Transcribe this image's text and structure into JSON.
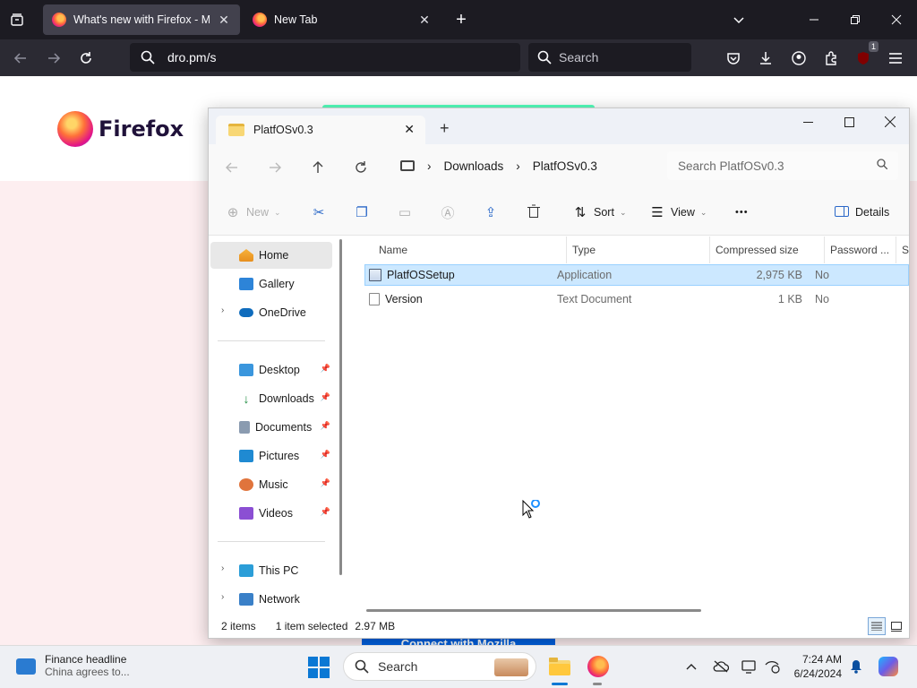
{
  "browser": {
    "tabs": [
      {
        "title": "What's new with Firefox - More",
        "close": "✕"
      },
      {
        "title": "New Tab",
        "close": "✕"
      }
    ],
    "new_tab": "+",
    "url": "dro.pm/s",
    "search_placeholder": "Search",
    "extension_badge": "1"
  },
  "page": {
    "logo_text": "Firefox",
    "cta": "Connect with Mozilla"
  },
  "explorer": {
    "tab_title": "PlatfOSv0.3",
    "breadcrumb": [
      "Downloads",
      "PlatfOSv0.3"
    ],
    "search_placeholder": "Search PlatfOSv0.3",
    "toolbar": {
      "new": "New",
      "sort": "Sort",
      "view": "View",
      "more": "•••",
      "details": "Details"
    },
    "nav": {
      "home": "Home",
      "gallery": "Gallery",
      "onedrive": "OneDrive",
      "desktop": "Desktop",
      "downloads": "Downloads",
      "documents": "Documents",
      "pictures": "Pictures",
      "music": "Music",
      "videos": "Videos",
      "this_pc": "This PC",
      "network": "Network"
    },
    "columns": [
      "Name",
      "Type",
      "Compressed size",
      "Password ...",
      "Si"
    ],
    "files": [
      {
        "name": "PlatfOSSetup",
        "type": "Application",
        "size": "2,975 KB",
        "password": "No"
      },
      {
        "name": "Version",
        "type": "Text Document",
        "size": "1 KB",
        "password": "No"
      }
    ],
    "status": {
      "items": "2 items",
      "selected": "1 item selected",
      "size": "2.97 MB"
    }
  },
  "taskbar": {
    "news_title": "Finance headline",
    "news_sub": "China agrees to...",
    "search": "Search",
    "time": "7:24 AM",
    "date": "6/24/2024"
  },
  "colors": {
    "browser_bg": "#1c1b22",
    "accent": "#0a78d4",
    "selection": "#cce8ff"
  }
}
